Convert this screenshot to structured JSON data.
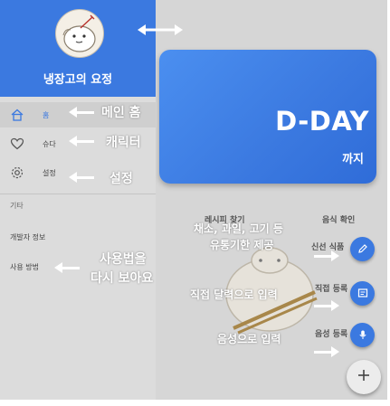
{
  "colors": {
    "accent": "#3b79e0",
    "drawer_bg": "#dcdcdc",
    "main_overlay": "#d6d6d6",
    "annotation_text": "#ffffff"
  },
  "drawer": {
    "app_name": "냉장고의 요정",
    "avatar_icon": "character-avatar",
    "menu": [
      {
        "label": "홈",
        "icon": "home-icon",
        "selected": true
      },
      {
        "label": "슈다",
        "icon": "heart-icon",
        "selected": false
      },
      {
        "label": "설정",
        "icon": "gear-icon",
        "selected": false
      }
    ],
    "section_label": "기타",
    "sub_items": [
      {
        "label": "개발자 정보"
      },
      {
        "label": "사용 방법"
      }
    ]
  },
  "main": {
    "dday_title": "D-DAY",
    "dday_sub": "까지",
    "tabs": [
      {
        "label": "레시피 찾기"
      },
      {
        "label": "음식 확인"
      }
    ],
    "fab_actions": [
      {
        "label": "신선 식품",
        "icon": "pencil-icon"
      },
      {
        "label": "직접 등록",
        "icon": "form-icon"
      },
      {
        "label": "음성 등록",
        "icon": "microphone-icon"
      }
    ],
    "add_icon": "plus-icon"
  },
  "annotations": {
    "home": "메인 홈",
    "character": "캐릭터",
    "settings": "설정",
    "howto_line1": "사용법을",
    "howto_line2": "다시 보아요",
    "fresh_line1": "채소, 과일, 고기 등",
    "fresh_line2": "유통기한 제공",
    "direct": "직접 달력으로 입력",
    "voice": "음성으로 입력"
  }
}
